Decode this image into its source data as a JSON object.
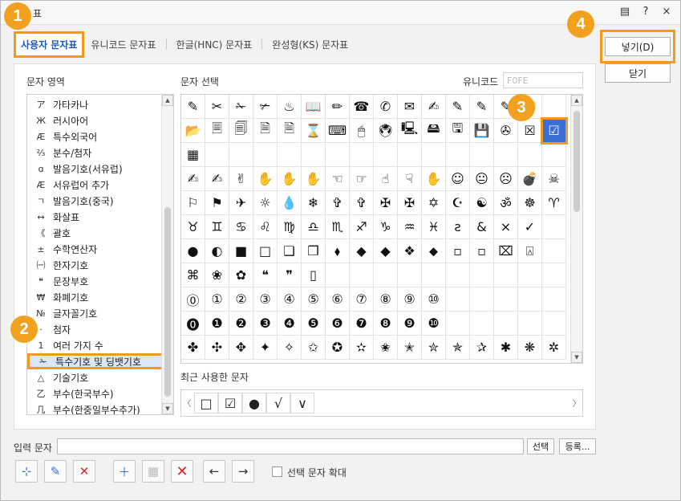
{
  "window": {
    "title": "표"
  },
  "titlebar": {
    "help": "?",
    "close": "×",
    "menu": "▤"
  },
  "tabs": [
    {
      "label": "사용자 문자표"
    },
    {
      "label": "유니코드 문자표"
    },
    {
      "label": "한글(HNC) 문자표"
    },
    {
      "label": "완성형(KS) 문자표"
    }
  ],
  "labels": {
    "category_area": "문자 영역",
    "char_select": "문자 선택",
    "unicode": "유니코드",
    "unicode_value": "F0FE",
    "recent": "최근 사용한 문자",
    "input_chars": "입력 문자",
    "enlarge": "선택 문자 확대"
  },
  "buttons": {
    "insert": "넣기(D)",
    "close": "닫기",
    "select": "선택",
    "register": "등록..."
  },
  "badges": [
    "1",
    "2",
    "3",
    "4"
  ],
  "categories": [
    {
      "icon": "ア",
      "label": "가타카나"
    },
    {
      "icon": "Ж",
      "label": "러시아어"
    },
    {
      "icon": "Æ",
      "label": "특수외국어"
    },
    {
      "icon": "⅔",
      "label": "분수/첨자"
    },
    {
      "icon": "ɑ",
      "label": "발음기호(서유럽)"
    },
    {
      "icon": "Æ",
      "label": "서유럽어 추가"
    },
    {
      "icon": "ㄱ",
      "label": "발음기호(중국)"
    },
    {
      "icon": "↔",
      "label": "화살표"
    },
    {
      "icon": "《",
      "label": "괄호"
    },
    {
      "icon": "±",
      "label": "수학연산자"
    },
    {
      "icon": "㈠",
      "label": "한자기호"
    },
    {
      "icon": "❝",
      "label": "문장부호"
    },
    {
      "icon": "₩",
      "label": "화폐기호"
    },
    {
      "icon": "№",
      "label": "글자꼴기호"
    },
    {
      "icon": "·",
      "label": "첨자"
    },
    {
      "icon": "1",
      "label": "여러 가지 수"
    },
    {
      "icon": "✁",
      "label": "특수기호 및 딩뱃기호"
    },
    {
      "icon": "△",
      "label": "기술기호"
    },
    {
      "icon": "乙",
      "label": "부수(한국부수)"
    },
    {
      "icon": "几",
      "label": "부수(한중일부수추가)"
    }
  ],
  "grid_rows": [
    [
      "✎",
      "✂",
      "✁",
      "✃",
      "♨",
      "📖",
      "✏",
      "☎",
      "✆",
      "✉",
      "✍",
      "✎",
      "✎",
      "✎",
      "📁"
    ],
    [
      "📂",
      "🗏",
      "🗐",
      "🗎",
      "🗎",
      "⌛",
      "⌨",
      "🖱",
      "🖲",
      "🖳",
      "🖴",
      "🖫",
      "💾",
      "✇",
      "☒",
      "☑"
    ],
    [
      "▦"
    ],
    [
      "✍",
      "✍",
      "✌",
      "✋",
      "✋",
      "✋",
      "☜",
      "☞",
      "☝",
      "☟",
      "✋",
      "☺",
      "😐",
      "☹",
      "💣",
      "☠"
    ],
    [
      "⚐",
      "⚑",
      "✈",
      "☼",
      "💧",
      "❄",
      "✞",
      "✞",
      "✠",
      "✠",
      "✡",
      "☪",
      "☯",
      "ॐ",
      "☸",
      "♈"
    ],
    [
      "♉",
      "♊",
      "♋",
      "♌",
      "♍",
      "♎",
      "♏",
      "♐",
      "♑",
      "♒",
      "♓",
      "ƨ",
      "&",
      "×",
      "✓"
    ],
    [
      "●",
      "◐",
      "■",
      "□",
      "❑",
      "❒",
      "⬧",
      "◆",
      "◆",
      "❖",
      "⬥",
      "▫",
      "▫",
      "⌧",
      "⍓"
    ],
    [
      "⌘",
      "❀",
      "✿",
      "❝",
      "❞",
      "▯"
    ],
    [
      "⓪",
      "①",
      "②",
      "③",
      "④",
      "⑤",
      "⑥",
      "⑦",
      "⑧",
      "⑨",
      "⑩"
    ],
    [
      "⓿",
      "❶",
      "❷",
      "❸",
      "❹",
      "❺",
      "❻",
      "❼",
      "❽",
      "❾",
      "❿"
    ],
    [
      "✤",
      "✣",
      "✥",
      "✦",
      "✧",
      "✩",
      "✪",
      "✫",
      "✬",
      "✭",
      "✮",
      "✯",
      "✰",
      "✱",
      "❋",
      "✲"
    ]
  ],
  "recent_chars": [
    "□",
    "☑",
    "●",
    "√",
    "∨"
  ]
}
